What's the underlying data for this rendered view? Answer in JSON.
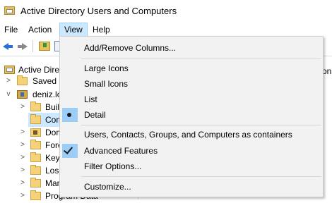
{
  "window": {
    "title": "Active Directory Users and Computers"
  },
  "menubar": {
    "items": [
      {
        "label": "File"
      },
      {
        "label": "Action"
      },
      {
        "label": "View"
      },
      {
        "label": "Help"
      }
    ]
  },
  "toolbar": {
    "icons": [
      "back-arrow-icon",
      "forward-arrow-icon",
      "folder-up-icon",
      "properties-icon"
    ]
  },
  "tree": {
    "items": [
      {
        "label": "Active Directo",
        "icon": "ad-root-icon",
        "expander": ""
      },
      {
        "label": "Saved Q",
        "icon": "folder-icon",
        "expander": ">"
      },
      {
        "label": "deniz.lo",
        "icon": "domain-icon",
        "expander": "v"
      },
      {
        "label": "Buil",
        "icon": "folder-icon",
        "expander": ">"
      },
      {
        "label": "Com",
        "icon": "folder-icon",
        "expander": ""
      },
      {
        "label": "Dom",
        "icon": "special-folder-icon",
        "expander": ">"
      },
      {
        "label": "Fore",
        "icon": "folder-icon",
        "expander": ">"
      },
      {
        "label": "Key",
        "icon": "folder-icon",
        "expander": ">"
      },
      {
        "label": "Los",
        "icon": "folder-icon",
        "expander": ">"
      },
      {
        "label": "Man",
        "icon": "folder-icon",
        "expander": ">"
      },
      {
        "label": "Program Data",
        "icon": "folder-icon",
        "expander": ">"
      }
    ]
  },
  "right_pane": {
    "partial_header": "on"
  },
  "view_menu": {
    "items": [
      {
        "label": "Add/Remove Columns...",
        "mark": ""
      },
      {
        "label": "Large Icons",
        "mark": ""
      },
      {
        "label": "Small Icons",
        "mark": ""
      },
      {
        "label": "List",
        "mark": ""
      },
      {
        "label": "Detail",
        "mark": "bullet"
      },
      {
        "label": "Users, Contacts, Groups, and Computers as containers",
        "mark": ""
      },
      {
        "label": "Advanced Features",
        "mark": "check"
      },
      {
        "label": "Filter Options...",
        "mark": ""
      },
      {
        "label": "Customize...",
        "mark": ""
      }
    ]
  },
  "colors": {
    "menu_highlight": "#cce8ff",
    "check_highlight": "#9ccdf7",
    "menu_bg": "#f2f2f2"
  }
}
